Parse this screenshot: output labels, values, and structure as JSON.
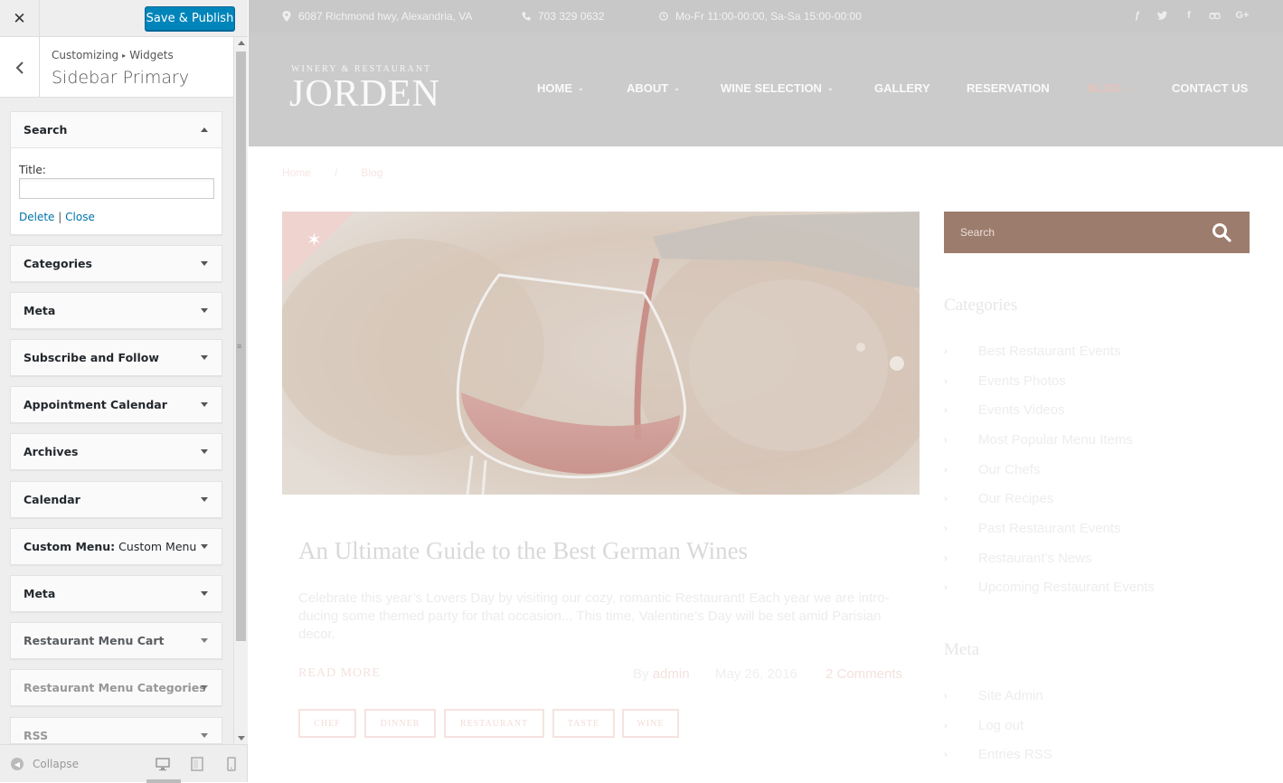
{
  "customizer": {
    "close_label": "✕",
    "publish_label": "Save & Publish",
    "breadcrumb": {
      "root": "Customizing",
      "sep": "▸",
      "current": "Widgets"
    },
    "section_title": "Sidebar Primary",
    "open_widget": {
      "title": "Search",
      "field_label": "Title:",
      "field_value": "",
      "delete_label": "Delete",
      "separator": "|",
      "close_label": "Close"
    },
    "widgets": [
      {
        "title": "Categories",
        "sub": ""
      },
      {
        "title": "Meta",
        "sub": ""
      },
      {
        "title": "Subscribe and Follow",
        "sub": ""
      },
      {
        "title": "Appointment Calendar",
        "sub": ""
      },
      {
        "title": "Archives",
        "sub": ""
      },
      {
        "title": "Calendar",
        "sub": ""
      },
      {
        "title": "Custom Menu:",
        "sub": "Custom Menu"
      },
      {
        "title": "Meta",
        "sub": ""
      },
      {
        "title": "Restaurant Menu Cart",
        "sub": ""
      },
      {
        "title": "Restaurant Menu Categories",
        "sub": ""
      },
      {
        "title": "RSS",
        "sub": ""
      }
    ],
    "collapse_label": "Collapse"
  },
  "site": {
    "topbar": {
      "address": "6087 Richmond hwy, Alexandria, VA",
      "phone": "703 329 0632",
      "hours": "Mo-Fr 11:00-00:00, Sa-Sa 15:00-00:00"
    },
    "logo": {
      "tagline": "WINERY & RESTAURANT",
      "name": "JORDEN"
    },
    "nav": [
      {
        "label": "HOME",
        "has_dropdown": true
      },
      {
        "label": "ABOUT",
        "has_dropdown": true
      },
      {
        "label": "WINE SELECTION",
        "has_dropdown": true
      },
      {
        "label": "GALLERY",
        "has_dropdown": false
      },
      {
        "label": "RESERVATION",
        "has_dropdown": false
      },
      {
        "label": "BLOG",
        "has_dropdown": true
      },
      {
        "label": "CONTACT US",
        "has_dropdown": false
      }
    ],
    "breadcrumb": {
      "home": "Home",
      "sep": "/",
      "current": "Blog"
    },
    "post": {
      "title": "An Ultimate Guide to the Best German Wines",
      "excerpt": "Celebrate this year’s Lovers Day by visiting our cozy, romantic Restaurant! Each year we are intro-ducing some themed party for that occasion... This time, Valentine’s Day will be set amid Parisian decor.",
      "read_more": "READ MORE",
      "by_label": "By",
      "author": "admin",
      "date": "May 26, 2016",
      "comments": "2 Comments",
      "tags": [
        "CHEF",
        "DINNER",
        "RESTAURANT",
        "TASTE",
        "WINE"
      ]
    },
    "sidebar": {
      "search_placeholder": "Search",
      "categories_title": "Categories",
      "categories": [
        "Best Restaurant Events",
        "Events Photos",
        "Events Videos",
        "Most Popular Menu Items",
        "Our Chefs",
        "Our Recipes",
        "Past Restaurant Events",
        "Restaurant’s News",
        "Upcoming Restaurant Events"
      ],
      "meta_title": "Meta",
      "meta": [
        "Site Admin",
        "Log out",
        "Entries RSS"
      ]
    }
  },
  "colors": {
    "publish_button": "#0085ba",
    "search_box": "#9c7c6c",
    "active_nav": "#e7c3bd",
    "link": "#0073aa"
  }
}
